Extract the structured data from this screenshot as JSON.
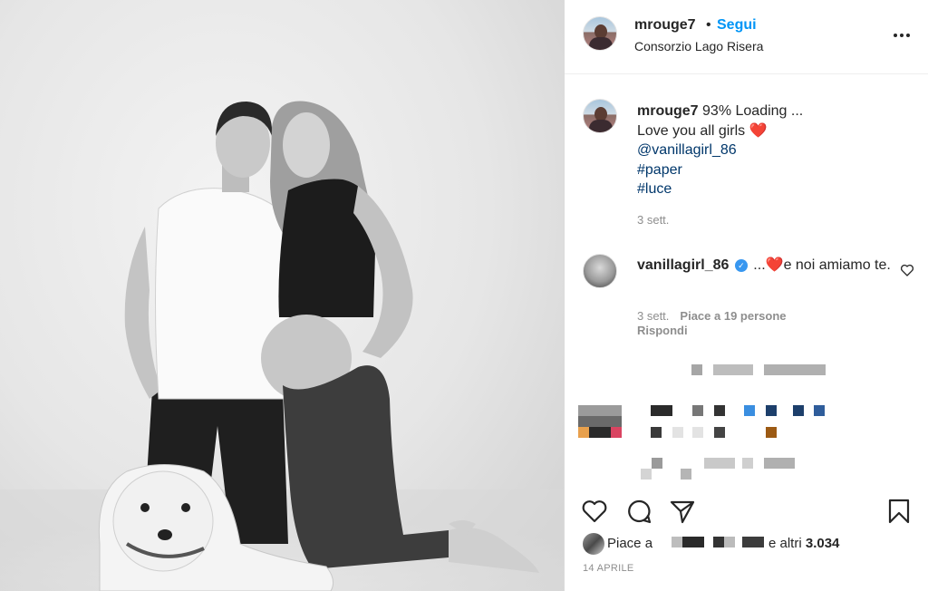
{
  "post": {
    "username": "mrouge7",
    "follow_dot": "•",
    "follow_label": "Segui",
    "location": "Consorzio Lago Risera"
  },
  "caption": {
    "username": "mrouge7",
    "line1": "93% Loading ...",
    "line2": "Love you all girls",
    "heart": "❤️",
    "mention": "@vanillagirl_86",
    "hashtags": [
      "#paper",
      "#luce"
    ],
    "time": "3 sett."
  },
  "comment": {
    "username": "vanillagirl_86",
    "verified": "✓",
    "text_start": "...",
    "heart": "❤️",
    "text_end": "e noi amiamo te.",
    "time": "3 sett.",
    "likes": "Piace a 19 persone",
    "reply": "Rispondi"
  },
  "likes": {
    "prefix": "Piace a",
    "and": "e altri",
    "count": "3.034"
  },
  "date": "14 APRILE",
  "icons": {
    "like": "heart-outline-icon",
    "comment": "comment-bubble-icon",
    "share": "paper-plane-icon",
    "save": "bookmark-icon",
    "more": "more-dots-icon",
    "comment_like": "small-heart-icon"
  },
  "colors": {
    "link": "#00376b",
    "follow": "#0095f6",
    "muted": "#8e8e8e",
    "text": "#262626",
    "heart": "#ed2d3a",
    "verified": "#3897f0"
  }
}
